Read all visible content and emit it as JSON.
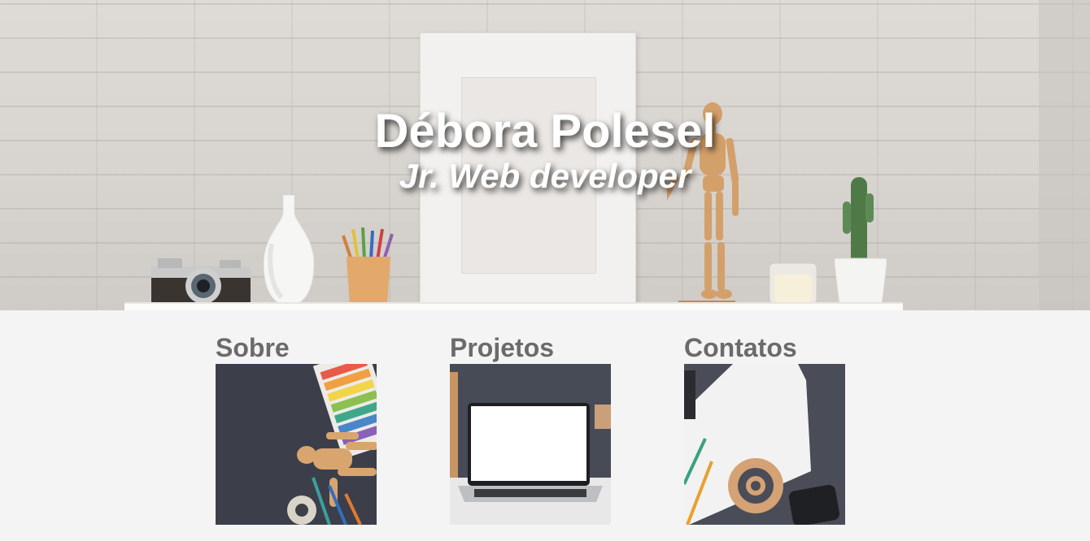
{
  "hero": {
    "title": "Débora Polesel",
    "subtitle": "Jr. Web developer"
  },
  "nav": {
    "cards": [
      {
        "label": "Sobre",
        "image": "mannequin-color-swatches-photo"
      },
      {
        "label": "Projetos",
        "image": "laptop-on-desk-photo"
      },
      {
        "label": "Contatos",
        "image": "at-sign-desk-photo"
      }
    ]
  },
  "colors": {
    "page_background": "#f4f4f4",
    "heading_text": "#6b6b6b",
    "hero_text": "#ffffff"
  }
}
